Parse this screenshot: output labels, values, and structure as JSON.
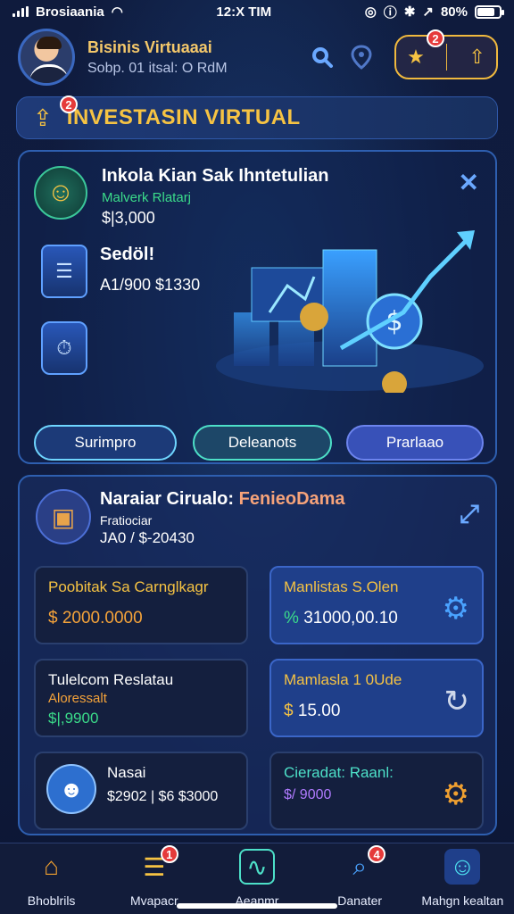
{
  "status_bar": {
    "carrier": "Brosiaania",
    "time": "12:X TIM",
    "battery": "80%",
    "battery_level": 0.8
  },
  "header": {
    "user_name": "Bisinis Virtuaaai",
    "user_sub": "Sobp. 01 itsal: O RdM",
    "notif_count": "2"
  },
  "title_bar": {
    "badge": "2",
    "title": "INVESTASIN VIRTUAL"
  },
  "main_card": {
    "item1": {
      "title": "Inkola Kian Sak Ihntetulian",
      "subtitle": "Malverk Rlatarj",
      "value": "$|3,000"
    },
    "item2": {
      "title": "Sedöl!",
      "value": "A1/900 $1330"
    },
    "buttons": {
      "b1": "Surimpro",
      "b2": "Deleanots",
      "b3": "Prarlaao"
    }
  },
  "section": {
    "title": "Naraiar Cirualo: ",
    "title_accent": "FenieoDama",
    "sub": "Fratiociar",
    "value": "JA0 / $-20430",
    "tiles": [
      {
        "title": "Poobitak Sa Carnglkagr",
        "value": "2000.0000",
        "prefix": "$"
      },
      {
        "title": "Manlistas S.Olen",
        "value": "31000,00.10",
        "prefix": "%"
      },
      {
        "title": "Tulelcom Reslatau",
        "sub": "Aloressalt",
        "value": "$|,9900"
      },
      {
        "title": "Mamlasla 1 0Ude",
        "value": "15.00",
        "prefix": "$"
      },
      {
        "title": "Nasai",
        "value": "$2902 | $6 $3000"
      },
      {
        "title": "Cieradat: Raanl:",
        "value": "$/ 9000"
      }
    ]
  },
  "tabs": [
    {
      "label": "Bhoblrils",
      "icon": "home-icon"
    },
    {
      "label": "Mvapacr",
      "icon": "document-icon",
      "badge": "1"
    },
    {
      "label": "Aeanmr",
      "icon": "chart-icon"
    },
    {
      "label": "Danater",
      "icon": "search-icon",
      "badge": "4"
    },
    {
      "label": "Mahgn kealtan",
      "icon": "profile-icon"
    }
  ]
}
